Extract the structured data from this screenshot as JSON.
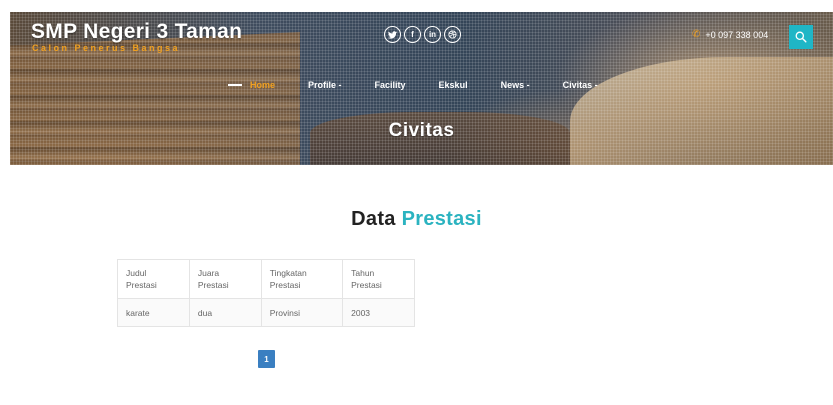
{
  "header": {
    "site_title": "SMP Negeri 3 Taman",
    "tagline": "Calon Penerus Bangsa",
    "social_icons": [
      "twitter-icon",
      "facebook-icon",
      "linkedin-icon",
      "dribbble-icon"
    ],
    "phone": "+0 097 338 004",
    "accent_color": "#1fb6c6",
    "tagline_color": "#f0a020"
  },
  "nav": {
    "items": [
      {
        "label": "Home",
        "active": true
      },
      {
        "label": "Profile -"
      },
      {
        "label": "Facility"
      },
      {
        "label": "Ekskul"
      },
      {
        "label": "News -"
      },
      {
        "label": "Civitas -"
      }
    ]
  },
  "hero": {
    "title": "Civitas"
  },
  "section": {
    "title_main": "Data",
    "title_accent": "Prestasi"
  },
  "table": {
    "headers": [
      [
        "Judul",
        "Prestasi"
      ],
      [
        "Juara",
        "Prestasi"
      ],
      [
        "Tingkatan",
        "Prestasi"
      ],
      [
        "Tahun",
        "Prestasi"
      ]
    ],
    "rows": [
      [
        "karate",
        "dua",
        "Provinsi",
        "2003"
      ]
    ]
  },
  "pagination": {
    "current_page": "1",
    "color": "#3a7fc1"
  }
}
